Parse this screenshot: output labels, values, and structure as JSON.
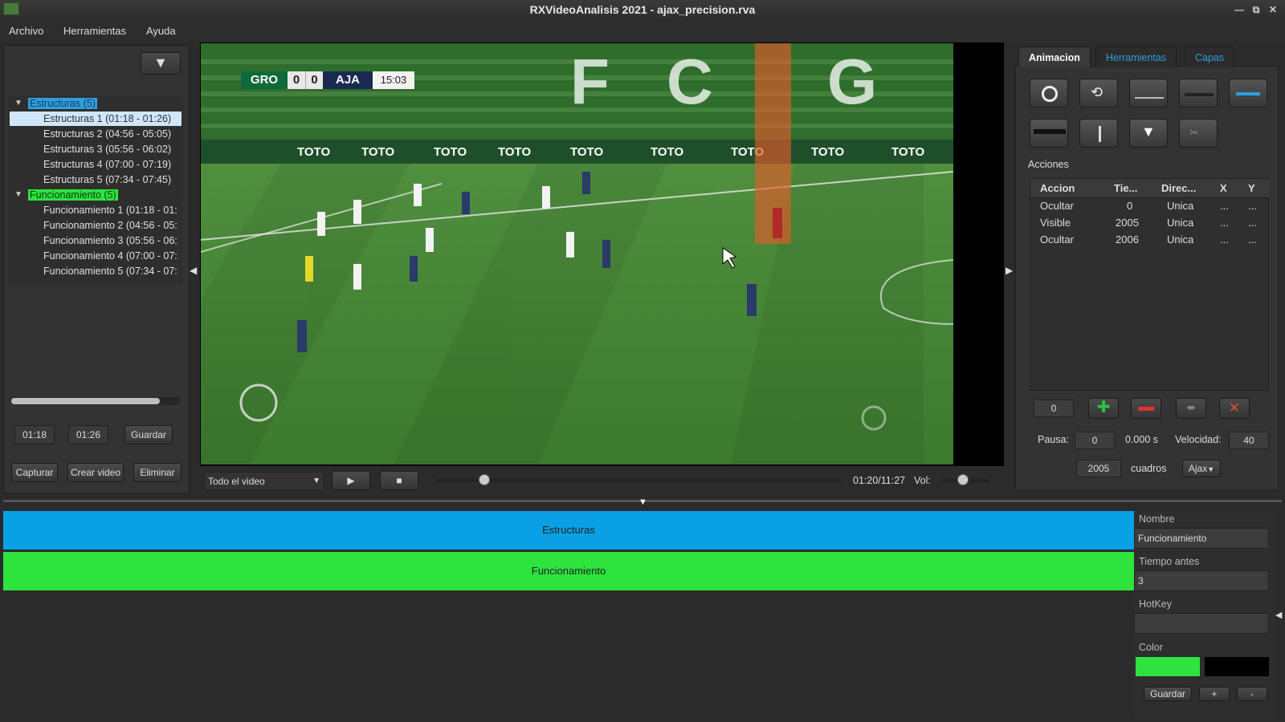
{
  "window": {
    "title": "RXVideoAnalisis 2021 - ajax_precision.rva",
    "minimize": "—",
    "restore": "⧉",
    "close": "✕"
  },
  "menu": {
    "items": [
      "Archivo",
      "Herramientas",
      "Ayuda"
    ]
  },
  "tree": {
    "groups": [
      {
        "label": "Estructuras (5)",
        "children": [
          "Estructuras 1 (01:18 - 01:26)",
          "Estructuras 2 (04:56 - 05:05)",
          "Estructuras 3 (05:56 - 06:02)",
          "Estructuras 4 (07:00 - 07:19)",
          "Estructuras 5 (07:34 - 07:45)"
        ]
      },
      {
        "label": "Funcionamiento (5)",
        "children": [
          "Funcionamiento 1 (01:18 - 01:",
          "Funcionamiento 2 (04:56 - 05:",
          "Funcionamiento 3 (05:56 - 06:",
          "Funcionamiento 4 (07:00 - 07:",
          "Funcionamiento 5 (07:34 - 07:"
        ]
      }
    ]
  },
  "clip": {
    "start": "01:18",
    "end": "01:26",
    "save_label": "Guardar",
    "capture_label": "Capturar",
    "create_video_label": "Crear video",
    "delete_label": "Eliminar"
  },
  "scoreboard": {
    "home": "GRO",
    "home_score": "0",
    "away_score": "0",
    "away": "AJA",
    "clock": "15:03"
  },
  "stadium": {
    "stands_letters": [
      "F",
      "C",
      "G"
    ],
    "ad_text": "TOTO"
  },
  "player": {
    "mode": "Todo el video",
    "position_fraction": 0.12,
    "time": "01:20/11:27",
    "vol_label": "Vol:",
    "volume_fraction": 0.45
  },
  "right_panel": {
    "tabs": [
      "Animacion",
      "Herramientas",
      "Capas"
    ],
    "actions_title": "Acciones",
    "table": {
      "headers": [
        "Accion",
        "Tie...",
        "Direc...",
        "X",
        "Y"
      ],
      "rows": [
        [
          "Ocultar",
          "0",
          "Unica",
          "...",
          "..."
        ],
        [
          "Visible",
          "2005",
          "Unica",
          "...",
          "..."
        ],
        [
          "Ocultar",
          "2006",
          "Unica",
          "...",
          "..."
        ]
      ]
    },
    "counter": "0",
    "pausa_label": "Pausa:",
    "pausa_value": "0",
    "pausa_seconds": "0.000 s",
    "velocidad_label": "Velocidad:",
    "velocidad_value": "40",
    "frames_value": "2005",
    "frames_label": "cuadros",
    "team_select": "Ajax"
  },
  "timeline": {
    "tracks": [
      {
        "label": "Estructuras",
        "color": "#0aa0e6"
      },
      {
        "label": "Funcionamiento",
        "color": "#2ee33e"
      }
    ]
  },
  "properties": {
    "nombre_label": "Nombre",
    "nombre_value": "Funcionamiento",
    "tiempo_label": "Tiempo antes",
    "tiempo_value": "3",
    "hotkey_label": "HotKey",
    "hotkey_value": "",
    "color_label": "Color",
    "color_value": "#2ee33e",
    "save_label": "Guardar",
    "add_label": "+",
    "remove_label": "-"
  }
}
